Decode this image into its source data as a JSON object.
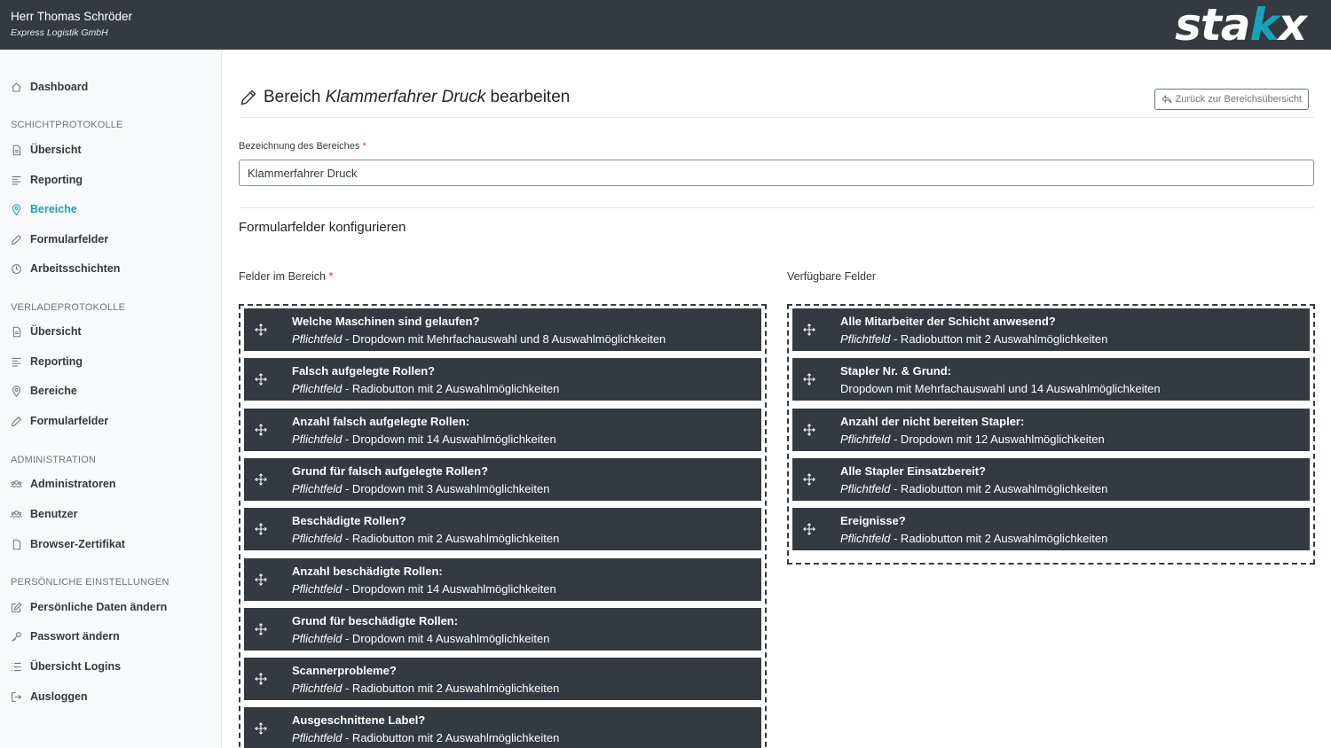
{
  "header": {
    "user_name": "Herr Thomas Schröder",
    "company": "Express Logistik GmbH",
    "logo_main": "sta",
    "logo_accent": "k",
    "logo_end": "x",
    "accent_color": "#17a2b8",
    "bar_color": "#343a40"
  },
  "sidebar": {
    "dashboard": "Dashboard",
    "sections": [
      {
        "heading": "SCHICHTPROTOKOLLE",
        "items": [
          "Übersicht",
          "Reporting",
          "Bereiche",
          "Formularfelder",
          "Arbeitsschichten"
        ]
      },
      {
        "heading": "VERLADEPROTOKOLLE",
        "items": [
          "Übersicht",
          "Reporting",
          "Bereiche",
          "Formularfelder"
        ]
      },
      {
        "heading": "ADMINISTRATION",
        "items": [
          "Administratoren",
          "Benutzer",
          "Browser-Zertifikat"
        ]
      },
      {
        "heading": "PERSÖNLICHE EINSTELLUNGEN",
        "items": [
          "Persönliche Daten ändern",
          "Passwort ändern",
          "Übersicht Logins",
          "Ausloggen"
        ]
      }
    ],
    "active_item": "Bereiche"
  },
  "main": {
    "title_prefix": "Bereich",
    "title_name": "Klammerfahrer Druck",
    "title_suffix": "bearbeiten",
    "back_button": "Zurück zur Bereichsübersicht",
    "name_label": "Bezeichnung des Bereiches",
    "required_marker": "*",
    "name_value": "Klammerfahrer Druck",
    "form_section_title": "Formularfelder konfigurieren",
    "fields_in_area_label": "Felder im Bereich",
    "available_fields_label": "Verfügbare Felder",
    "fields_in_area": [
      {
        "title": "Welche Maschinen sind gelaufen?",
        "required": "Pflichtfeld",
        "desc": " - Dropdown mit Mehrfachauswahl und 8 Auswahlmöglichkeiten"
      },
      {
        "title": "Falsch aufgelegte Rollen?",
        "required": "Pflichtfeld",
        "desc": " - Radiobutton mit 2 Auswahlmöglichkeiten"
      },
      {
        "title": "Anzahl falsch aufgelegte Rollen:",
        "required": "Pflichtfeld",
        "desc": " - Dropdown mit 14 Auswahlmöglichkeiten"
      },
      {
        "title": "Grund für falsch aufgelegte Rollen?",
        "required": "Pflichtfeld",
        "desc": " - Dropdown mit 3 Auswahlmöglichkeiten"
      },
      {
        "title": "Beschädigte Rollen?",
        "required": "Pflichtfeld",
        "desc": " - Radiobutton mit 2 Auswahlmöglichkeiten"
      },
      {
        "title": "Anzahl beschädigte Rollen:",
        "required": "Pflichtfeld",
        "desc": " - Dropdown mit 14 Auswahlmöglichkeiten"
      },
      {
        "title": "Grund für beschädigte Rollen:",
        "required": "Pflichtfeld",
        "desc": " - Dropdown mit 4 Auswahlmöglichkeiten"
      },
      {
        "title": "Scannerprobleme?",
        "required": "Pflichtfeld",
        "desc": " - Radiobutton mit 2 Auswahlmöglichkeiten"
      },
      {
        "title": "Ausgeschnittene Label?",
        "required": "Pflichtfeld",
        "desc": " - Radiobutton mit 2 Auswahlmöglichkeiten"
      }
    ],
    "available_fields": [
      {
        "title": "Alle Mitarbeiter der Schicht anwesend?",
        "required": "Pflichtfeld",
        "desc": " - Radiobutton mit 2 Auswahlmöglichkeiten"
      },
      {
        "title": "Stapler Nr. & Grund:",
        "required": "",
        "desc": "Dropdown mit Mehrfachauswahl und 14 Auswahlmöglichkeiten"
      },
      {
        "title": "Anzahl der nicht bereiten Stapler:",
        "required": "Pflichtfeld",
        "desc": " - Dropdown mit 12 Auswahlmöglichkeiten"
      },
      {
        "title": "Alle Stapler Einsatzbereit?",
        "required": "Pflichtfeld",
        "desc": " - Radiobutton mit 2 Auswahlmöglichkeiten"
      },
      {
        "title": "Ereignisse?",
        "required": "Pflichtfeld",
        "desc": " - Radiobutton mit 2 Auswahlmöglichkeiten"
      }
    ]
  }
}
